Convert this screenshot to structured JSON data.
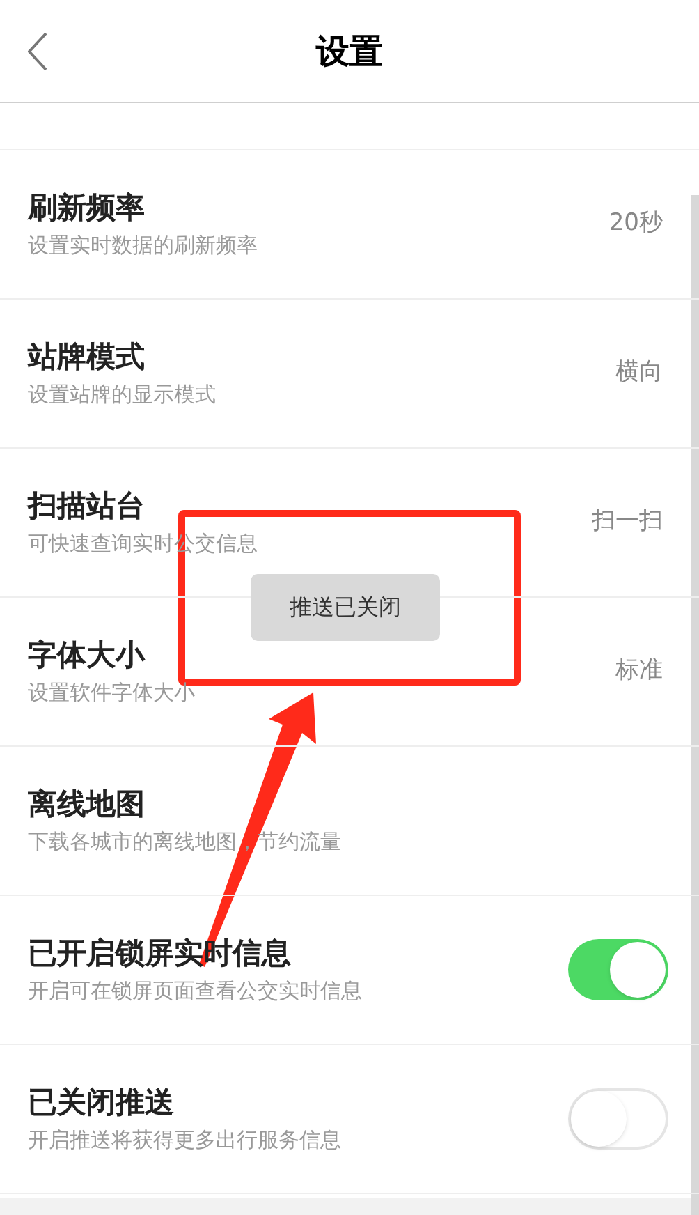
{
  "header": {
    "title": "设置"
  },
  "rows": [
    {
      "kind": "value",
      "title": "刷新频率",
      "subtitle": "设置实时数据的刷新频率",
      "value": "20秒"
    },
    {
      "kind": "value",
      "title": "站牌模式",
      "subtitle": "设置站牌的显示模式",
      "value": "横向"
    },
    {
      "kind": "value",
      "title": "扫描站台",
      "subtitle": "可快速查询实时公交信息",
      "value": "扫一扫"
    },
    {
      "kind": "value",
      "title": "字体大小",
      "subtitle": "设置软件字体大小",
      "value": "标准"
    },
    {
      "kind": "plain",
      "title": "离线地图",
      "subtitle": "下载各城市的离线地图，节约流量"
    },
    {
      "kind": "toggle",
      "title": "已开启锁屏实时信息",
      "subtitle": "开启可在锁屏页面查看公交实时信息",
      "on": true
    },
    {
      "kind": "toggle",
      "title": "已关闭推送",
      "subtitle": "开启推送将获得更多出行服务信息",
      "on": false
    }
  ],
  "toast": "推送已关闭"
}
